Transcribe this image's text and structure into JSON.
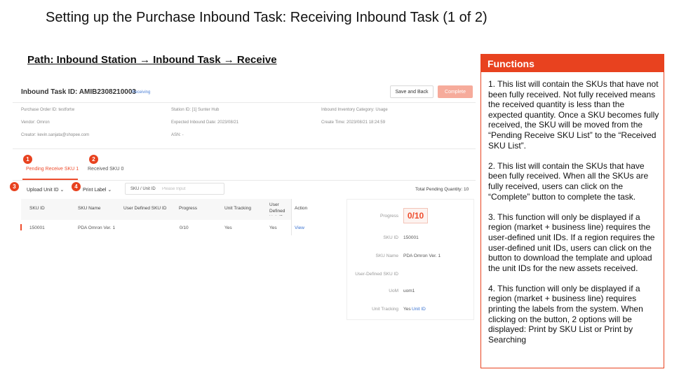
{
  "slide": {
    "title": "Setting up the Purchase Inbound Task: Receiving Inbound Task (1 of 2)",
    "path": "Path: Inbound Station → Inbound Task → Receive"
  },
  "task": {
    "title": "Inbound Task ID: AMIB2308210003",
    "status": "Receiving",
    "save_label": "Save and Back",
    "complete_label": "Complete",
    "meta": {
      "purchase_order": "Purchase Order ID: testfortw",
      "station": "Station ID: [1] Sunter Hub",
      "category": "Inbound Inventory Category: Usage",
      "vendor": "Vendor: Omron",
      "expected_date": "Expected Inbound Date: 2023/08/21",
      "create_time": "Create Time: 2023/08/21 18:24:59",
      "creator": "Creator: kevin.sanjata@shopee.com",
      "asn": "ASN: -"
    }
  },
  "tabs": [
    {
      "label": "Pending Receive SKU 1",
      "active": true
    },
    {
      "label": "Received SKU 0",
      "active": false
    }
  ],
  "toolbar": {
    "upload_label": "Upload Unit ID ⌄",
    "print_label": "Print Label ⌄",
    "search_label": "SKU / Unit ID",
    "search_placeholder": "Please Input",
    "total_pending": "Total Pending Quantity: 10"
  },
  "table": {
    "columns": [
      "SKU ID",
      "SKU Name",
      "User Defined SKU ID",
      "Progress",
      "Unit Tracking",
      "User Defined Unit ID",
      "Action"
    ],
    "rows": [
      {
        "sku_id": "150001",
        "sku_name": "PDA Omron Ver. 1",
        "user_sku": "",
        "progress": "0/10",
        "tracking": "Yes",
        "user_unit": "Yes",
        "action": "View"
      }
    ]
  },
  "detail": {
    "progress_label": "Progress",
    "progress_value": "0/10",
    "progress_fraction": 0,
    "fields": [
      {
        "label": "SKU ID",
        "value": "150001"
      },
      {
        "label": "SKU Name",
        "value": "PDA Omron Ver. 1"
      },
      {
        "label": "User-Defined SKU ID",
        "value": ""
      },
      {
        "label": "UoM",
        "value": "uom1"
      },
      {
        "label": "Unit Tracking",
        "value": "Yes",
        "link": "Unit ID"
      }
    ]
  },
  "badges": [
    "1",
    "2",
    "3",
    "4"
  ],
  "functions": {
    "header": "Functions",
    "items": [
      "1. This list will contain the SKUs that have not been fully received. Not fully received means the received quantity is less than the expected quantity. Once a SKU becomes fully received, the SKU will be moved from the “Pending Receive SKU List” to the “Received SKU List”.",
      "2. This list will contain the SKUs that have been fully received. When all the SKUs are fully received, users can click on the “Complete” button to complete the task.",
      "3.  This function will only be displayed if a region (market + business line) requires the user-defined unit IDs. If a region requires the user-defined unit IDs, users can click on the button to download the template and upload the unit IDs for the new assets received.",
      "4. This function will only be displayed if a region (market + business line) requires printing the labels from the system. When clicking on the button, 2 options will be displayed: Print by SKU List or Print by Searching"
    ]
  },
  "colors": {
    "accent": "#e8421f",
    "link": "#3b73d1"
  }
}
